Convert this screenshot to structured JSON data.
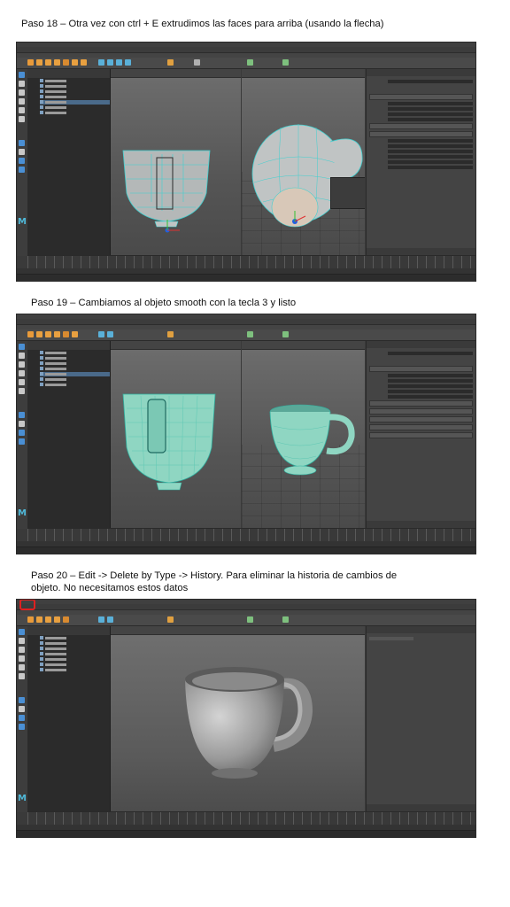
{
  "captions": {
    "step18": "Paso 18 – Otra vez con ctrl + E extrudimos las faces para arriba (usando la flecha)",
    "step19": "Paso 19 – Cambiamos al objeto smooth con la tecla 3 y listo",
    "step20_line1": "Paso 20 – Edit -> Delete by Type -> History. Para eliminar la historia de cambios de",
    "step20_line2": "objeto. No necesitamos estos datos"
  },
  "screenshots": [
    {
      "id": "step18",
      "view": "split",
      "mode": "wireframe-extrude",
      "highlight": "none"
    },
    {
      "id": "step19",
      "view": "split",
      "mode": "smooth",
      "highlight": "none"
    },
    {
      "id": "step20",
      "view": "single",
      "mode": "history-deleted",
      "highlight": "edit-menu"
    }
  ],
  "colors": {
    "wire": "#3fd0d0",
    "mesh_shaded": "#b8bcbc",
    "smooth_mesh": "#8fd6c2",
    "highlight": "#e02020",
    "maya_ui_bg": "#3a3a3a"
  }
}
